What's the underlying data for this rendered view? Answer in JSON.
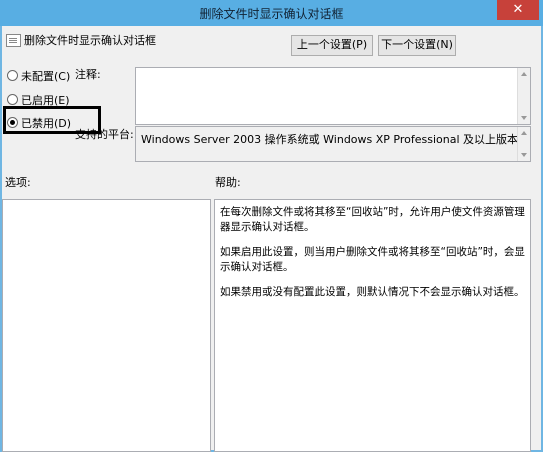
{
  "window": {
    "title": "删除文件时显示确认对话框",
    "close_glyph": "✕"
  },
  "header": {
    "policy_name": "删除文件时显示确认对话框",
    "prev_button": "上一个设置(P)",
    "next_button": "下一个设置(N)"
  },
  "radios": [
    {
      "label": "未配置(C)",
      "selected": false
    },
    {
      "label": "已启用(E)",
      "selected": false
    },
    {
      "label": "已禁用(D)",
      "selected": true
    }
  ],
  "labels": {
    "comment": "注释:",
    "platform": "支持的平台:",
    "options": "选项:",
    "help": "帮助:"
  },
  "platform_text": "Windows Server 2003 操作系统或 Windows XP Professional 及以上版本",
  "help_paragraphs": [
    "在每次删除文件或将其移至“回收站”时，允许用户使文件资源管理器显示确认对话框。",
    "如果启用此设置，则当用户删除文件或将其移至“回收站”时，会显示确认对话框。",
    "如果禁用或没有配置此设置，则默认情况下不会显示确认对话框。"
  ]
}
